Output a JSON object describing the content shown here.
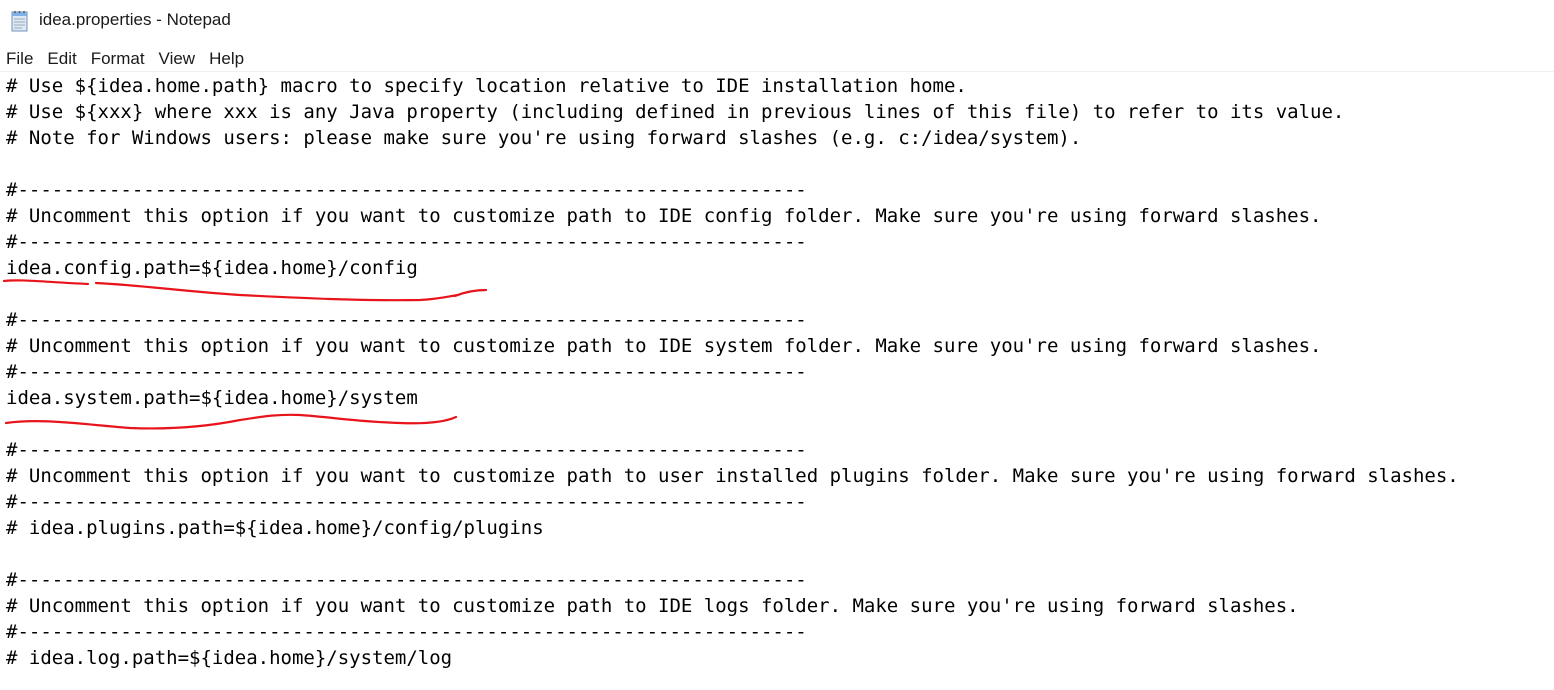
{
  "window": {
    "title": "idea.properties - Notepad",
    "icon": "notepad-icon"
  },
  "menu": [
    "File",
    "Edit",
    "Format",
    "View",
    "Help"
  ],
  "lines": [
    "# Use ${idea.home.path} macro to specify location relative to IDE installation home.",
    "# Use ${xxx} where xxx is any Java property (including defined in previous lines of this file) to refer to its value.",
    "# Note for Windows users: please make sure you're using forward slashes (e.g. c:/idea/system).",
    "",
    "#---------------------------------------------------------------------",
    "# Uncomment this option if you want to customize path to IDE config folder. Make sure you're using forward slashes.",
    "#---------------------------------------------------------------------",
    "idea.config.path=${idea.home}/config",
    "",
    "#---------------------------------------------------------------------",
    "# Uncomment this option if you want to customize path to IDE system folder. Make sure you're using forward slashes.",
    "#---------------------------------------------------------------------",
    "idea.system.path=${idea.home}/system",
    "",
    "#---------------------------------------------------------------------",
    "# Uncomment this option if you want to customize path to user installed plugins folder. Make sure you're using forward slashes.",
    "#---------------------------------------------------------------------",
    "# idea.plugins.path=${idea.home}/config/plugins",
    "",
    "#---------------------------------------------------------------------",
    "# Uncomment this option if you want to customize path to IDE logs folder. Make sure you're using forward slashes.",
    "#---------------------------------------------------------------------",
    "# idea.log.path=${idea.home}/system/log"
  ],
  "colors": {
    "annotation": "#e8141b",
    "text": "#000000",
    "background": "#ffffff"
  }
}
